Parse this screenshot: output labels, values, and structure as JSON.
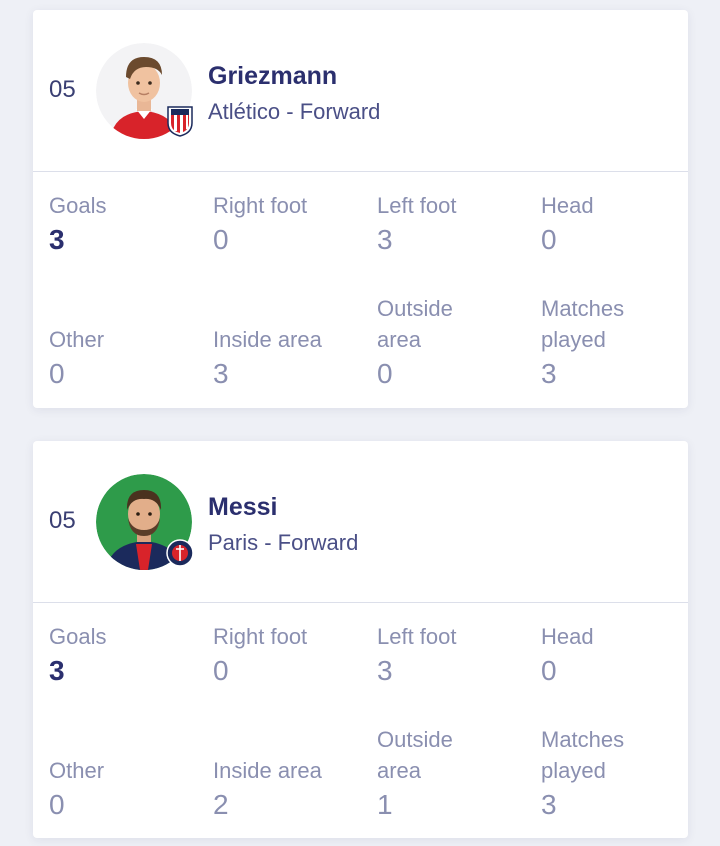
{
  "players": [
    {
      "rank": "05",
      "name": "Griezmann",
      "subtitle": "Atlético - Forward",
      "club_icon": "atletico-badge-icon",
      "stats": {
        "goals": {
          "label": "Goals",
          "value": "3"
        },
        "right_foot": {
          "label": "Right foot",
          "value": "0"
        },
        "left_foot": {
          "label": "Left foot",
          "value": "3"
        },
        "head": {
          "label": "Head",
          "value": "0"
        },
        "other": {
          "label": "Other",
          "value": "0"
        },
        "inside_area": {
          "label": "Inside area",
          "value": "3"
        },
        "outside_area": {
          "label": "Outside area",
          "value": "0"
        },
        "matches_played": {
          "label": "Matches played",
          "value": "3"
        }
      }
    },
    {
      "rank": "05",
      "name": "Messi",
      "subtitle": "Paris - Forward",
      "club_icon": "psg-badge-icon",
      "stats": {
        "goals": {
          "label": "Goals",
          "value": "3"
        },
        "right_foot": {
          "label": "Right foot",
          "value": "0"
        },
        "left_foot": {
          "label": "Left foot",
          "value": "3"
        },
        "head": {
          "label": "Head",
          "value": "0"
        },
        "other": {
          "label": "Other",
          "value": "0"
        },
        "inside_area": {
          "label": "Inside area",
          "value": "2"
        },
        "outside_area": {
          "label": "Outside area",
          "value": "1"
        },
        "matches_played": {
          "label": "Matches played",
          "value": "3"
        }
      }
    }
  ],
  "colors": {
    "background": "#eef0f6",
    "card": "#ffffff",
    "name": "#2b2f6e",
    "muted": "#8a8fb0",
    "atletico_red": "#d8232a",
    "psg_navy": "#1b2a5c",
    "messi_avatar_bg": "#2e9b4a"
  }
}
